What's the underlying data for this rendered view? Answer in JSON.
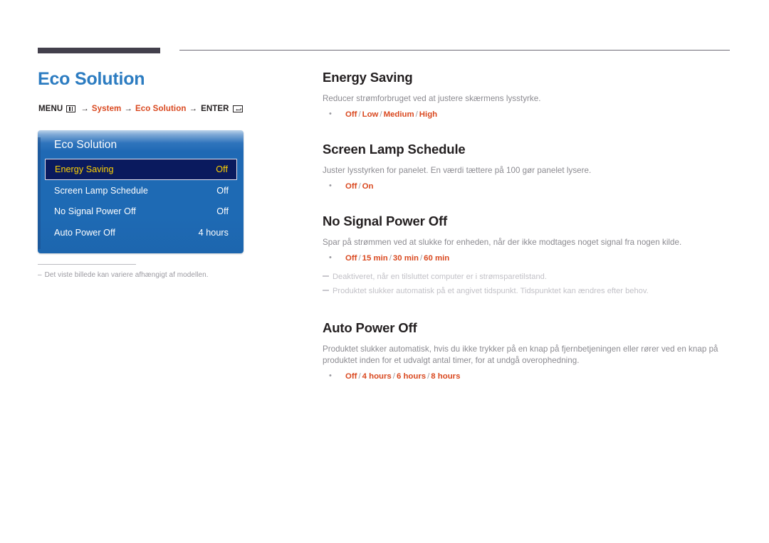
{
  "header": {
    "rule_color": "#43404c"
  },
  "left": {
    "page_title": "Eco Solution",
    "breadcrumb": {
      "menu_label": "MENU",
      "menu_icon": "menu-grid-icon",
      "arrow": "→",
      "step1": "System",
      "step2": "Eco Solution",
      "enter_label": "ENTER",
      "enter_icon": "enter-key-icon"
    },
    "osd": {
      "title": "Eco Solution",
      "rows": [
        {
          "label": "Energy Saving",
          "value": "Off",
          "selected": true
        },
        {
          "label": "Screen Lamp Schedule",
          "value": "Off",
          "selected": false
        },
        {
          "label": "No Signal Power Off",
          "value": "Off",
          "selected": false
        },
        {
          "label": "Auto Power Off",
          "value": "4 hours",
          "selected": false
        }
      ],
      "colors": {
        "panel_blue": "#1e6ab4",
        "selected_bg": "#0a1a5e",
        "selected_text": "#ffd200"
      }
    },
    "footnote": {
      "dash": "–",
      "text": "Det viste billede kan variere afhængigt af modellen."
    }
  },
  "right": {
    "sections": [
      {
        "title": "Energy Saving",
        "desc": "Reducer strømforbruget ved at justere skærmens lysstyrke.",
        "options": [
          "Off",
          "Low",
          "Medium",
          "High"
        ],
        "notes": []
      },
      {
        "title": "Screen Lamp Schedule",
        "desc": "Juster lysstyrken for panelet. En værdi tættere på 100 gør panelet lysere.",
        "options": [
          "Off",
          "On"
        ],
        "notes": []
      },
      {
        "title": "No Signal Power Off",
        "desc": "Spar på strømmen ved at slukke for enheden, når der ikke modtages noget signal fra nogen kilde.",
        "options": [
          "Off",
          "15 min",
          "30 min",
          "60 min"
        ],
        "notes": [
          "Deaktiveret, når en tilsluttet computer er i strømsparetilstand.",
          "Produktet slukker automatisk på et angivet tidspunkt. Tidspunktet kan ændres efter behov."
        ]
      },
      {
        "title": "Auto Power Off",
        "desc": "Produktet slukker automatisk, hvis du ikke trykker på en knap på fjernbetjeningen eller rører ved en knap på produktet inden for et udvalgt antal timer, for at undgå overophedning.",
        "options": [
          "Off",
          "4 hours",
          "6 hours",
          "8 hours"
        ],
        "notes": []
      }
    ],
    "option_separator": "/",
    "accent_color": "#d9481f"
  }
}
